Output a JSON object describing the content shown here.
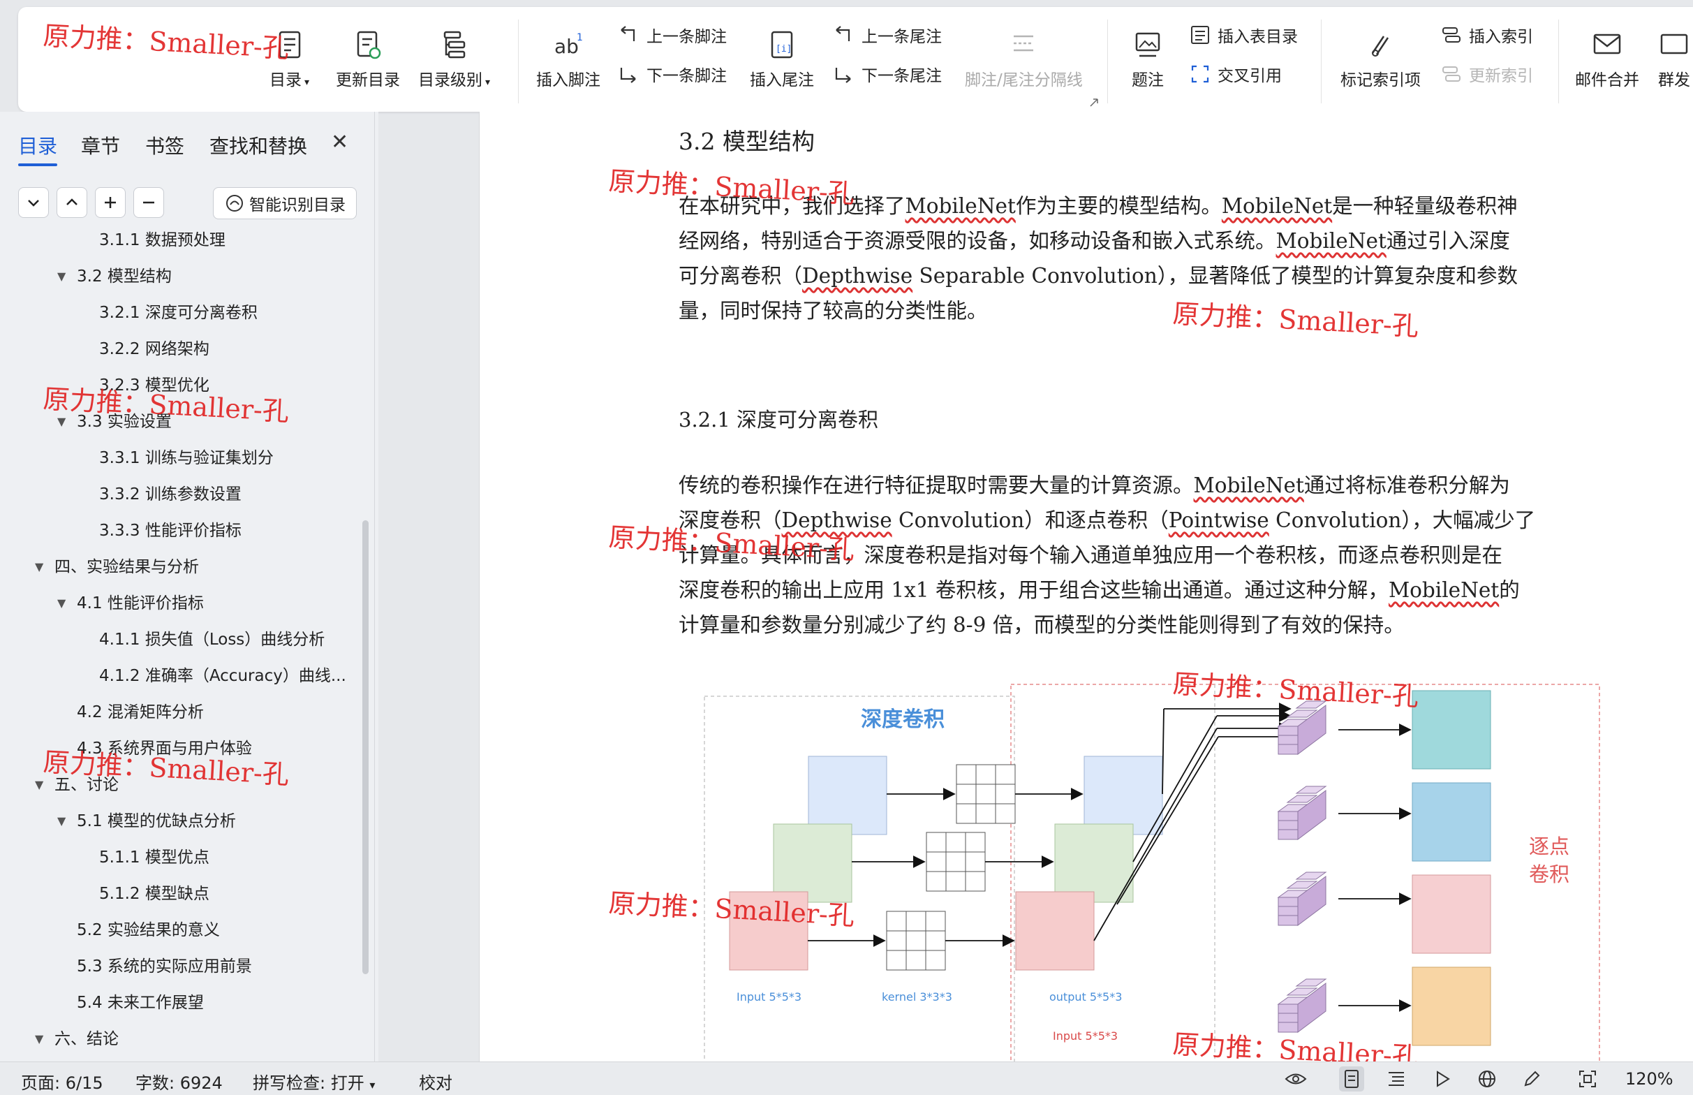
{
  "ribbon": {
    "toc_label": "目录",
    "update_toc_label": "更新目录",
    "toc_level_label": "目录级别",
    "insert_footnote_label": "插入脚注",
    "prev_footnote_label": "上一条脚注",
    "next_footnote_label": "下一条脚注",
    "insert_endnote_label": "插入尾注",
    "prev_endnote_label": "上一条尾注",
    "next_endnote_label": "下一条尾注",
    "separator_label": "脚注/尾注分隔线",
    "caption_label": "题注",
    "insert_table_toc_label": "插入表目录",
    "cross_ref_label": "交叉引用",
    "mark_index_label": "标记索引项",
    "insert_index_label": "插入索引",
    "update_index_label": "更新索引",
    "mail_merge_label": "邮件合并",
    "group_send_label": "群发"
  },
  "nav": {
    "tabs": [
      "目录",
      "章节",
      "书签",
      "查找和替换"
    ],
    "smart_toc_label": "智能识别目录",
    "items": [
      {
        "label": "3.1.1  数据预处理",
        "level": 3,
        "expanded": null
      },
      {
        "label": "3.2  模型结构",
        "level": 2,
        "expanded": true
      },
      {
        "label": "3.2.1  深度可分离卷积",
        "level": 3,
        "expanded": null
      },
      {
        "label": "3.2.2  网络架构",
        "level": 3,
        "expanded": null
      },
      {
        "label": "3.2.3  模型优化",
        "level": 3,
        "expanded": null
      },
      {
        "label": "3.3  实验设置",
        "level": 2,
        "expanded": true
      },
      {
        "label": "3.3.1  训练与验证集划分",
        "level": 3,
        "expanded": null
      },
      {
        "label": "3.3.2  训练参数设置",
        "level": 3,
        "expanded": null
      },
      {
        "label": "3.3.3  性能评价指标",
        "level": 3,
        "expanded": null
      },
      {
        "label": "四、实验结果与分析",
        "level": 1,
        "expanded": true
      },
      {
        "label": "4.1  性能评价指标",
        "level": 2,
        "expanded": true
      },
      {
        "label": "4.1.1  损失值（Loss）曲线分析",
        "level": 3,
        "expanded": null
      },
      {
        "label": "4.1.2  准确率（Accuracy）曲线...",
        "level": 3,
        "expanded": null
      },
      {
        "label": "4.2  混淆矩阵分析",
        "level": 2,
        "expanded": null
      },
      {
        "label": "4.3  系统界面与用户体验",
        "level": 2,
        "expanded": null
      },
      {
        "label": "五、讨论",
        "level": 1,
        "expanded": true
      },
      {
        "label": "5.1  模型的优缺点分析",
        "level": 2,
        "expanded": true
      },
      {
        "label": "5.1.1  模型优点",
        "level": 3,
        "expanded": null
      },
      {
        "label": "5.1.2  模型缺点",
        "level": 3,
        "expanded": null
      },
      {
        "label": "5.2  实验结果的意义",
        "level": 2,
        "expanded": null
      },
      {
        "label": "5.3  系统的实际应用前景",
        "level": 2,
        "expanded": null
      },
      {
        "label": "5.4  未来工作展望",
        "level": 2,
        "expanded": null
      },
      {
        "label": "六、结论",
        "level": 1,
        "expanded": true
      }
    ]
  },
  "doc": {
    "h_32": "3.2  模型结构",
    "p1": [
      [
        "在本研究中，我们选择了",
        "MobileNet",
        "作为主要的模型结构。",
        "MobileNet",
        "是一种轻量级卷积神"
      ],
      [
        "经网络，特别适合于资源受限的设备，如移动设备和嵌入式系统。",
        "MobileNet",
        "通过引入深度"
      ],
      [
        "可分离卷积（",
        "Depthwise",
        " Separable Convolution），显著降低了模型的计算复杂度和参数"
      ],
      [
        "量，同时保持了较高的分类性能。"
      ]
    ],
    "h_321": "3.2.1  深度可分离卷积",
    "p2": [
      [
        "传统的卷积操作在进行特征提取时需要大量的计算资源。",
        "MobileNet",
        "通过将标准卷积分解为"
      ],
      [
        "深度卷积（",
        "Depthwise",
        " Convolution）和逐点卷积（",
        "Pointwise",
        " Convolution），大幅减少了"
      ],
      [
        "计算量。具体而言，深度卷积是指对每个输入通道单独应用一个卷积核，而逐点卷积则是在"
      ],
      [
        "深度卷积的输出上应用 1x1 卷积核，用于组合这些输出通道。通过这种分解，",
        "MobileNet",
        "的"
      ],
      [
        "计算量和参数量分别减少了约 8-9 倍，而模型的分类性能则得到了有效的保持。"
      ]
    ],
    "figure": {
      "title_depthwise": "深度卷积",
      "title_pointwise_1": "逐点",
      "title_pointwise_2": "卷积",
      "label_input": "Input 5*5*3",
      "label_kernel": "kernel  3*3*3",
      "label_output": "output 5*5*3",
      "label_input2": "Input 5*5*3"
    }
  },
  "watermark": "原力推：Smaller-孔",
  "status": {
    "page": "页面: 6/15",
    "words": "字数: 6924",
    "spell": "拼写检查: 打开",
    "proof": "校对",
    "zoom": "120%"
  },
  "colors": {
    "accent": "#1f5fd6",
    "watermark": "#e02020",
    "fig_blue": "#dce8fa",
    "fig_green": "#dcebd6",
    "fig_red": "#f6cccc",
    "fig_cyan": "#9fd9dc",
    "fig_lightblue": "#a7d3ea",
    "fig_pink": "#f6cfd1",
    "fig_orange": "#f8d5a4",
    "fig_purple": "#d9c3e6"
  }
}
